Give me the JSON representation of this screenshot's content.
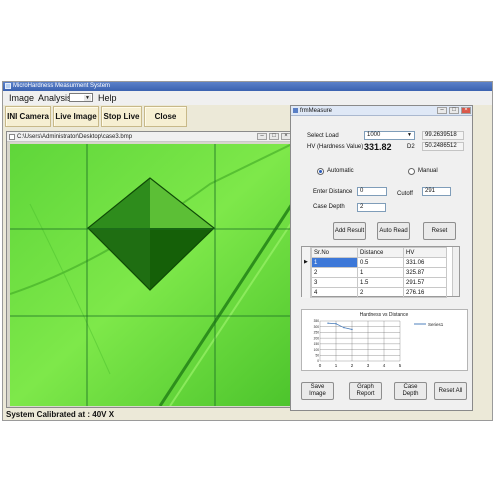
{
  "app": {
    "title": "MicroHardness Measurment System",
    "menu": [
      "Image",
      "Analysis",
      "Help"
    ],
    "toolbar": [
      "INI Camera",
      "Live Image",
      "Stop Live",
      "Close Cam"
    ],
    "status_label": "System Calibrated at :",
    "status_value": "40V  X"
  },
  "image_window": {
    "title": "C:\\Users\\Administrator\\Desktop\\case3.bmp",
    "buttons": [
      "–",
      "□",
      "×"
    ]
  },
  "measure": {
    "title": "frmMeasure",
    "window_buttons": [
      "–",
      "□",
      "×"
    ],
    "select_load_label": "Select Load",
    "select_load_value": "1000",
    "d1_value": "99.2639518",
    "hv_label": "HV (Hardness Value)",
    "hv_value": "331.82",
    "d2_label": "D2",
    "d2_value": "50.2486512",
    "mode_auto": "Automatic",
    "mode_manual": "Manual",
    "enter_distance_label": "Enter Distance",
    "enter_distance_value": "0",
    "cutoff_label": "Cutoff",
    "cutoff_value": "291",
    "case_depth_label": "Case Depth",
    "case_depth_value": "2",
    "buttons_top": [
      "Add Result",
      "Auto Read",
      "Reset"
    ],
    "columns": [
      "Sr.No",
      "Distance",
      "HV"
    ],
    "rows": [
      [
        "1",
        "0.5",
        "331.06"
      ],
      [
        "2",
        "1",
        "325.87"
      ],
      [
        "3",
        "1.5",
        "291.57"
      ],
      [
        "4",
        "2",
        "276.16"
      ]
    ],
    "buttons_bottom": [
      "Save Image",
      "Graph Report",
      "Case Depth",
      "Reset All"
    ]
  },
  "chart_data": {
    "type": "line",
    "title": "Hardness vs Distance",
    "x_ticks": [
      "0",
      "1",
      "2",
      "3",
      "4",
      "5"
    ],
    "y_ticks": [
      "350",
      "300",
      "250",
      "200",
      "150",
      "100",
      "50",
      "0"
    ],
    "xlim": [
      0,
      5
    ],
    "ylim": [
      0,
      350
    ],
    "grid": true,
    "legend_position": "right",
    "series": [
      {
        "name": "Series1",
        "x": [
          0.5,
          1,
          1.5,
          2
        ],
        "y": [
          331.06,
          325.87,
          291.57,
          276.16
        ]
      }
    ],
    "colors": {
      "series1": "#4f81bd"
    }
  }
}
